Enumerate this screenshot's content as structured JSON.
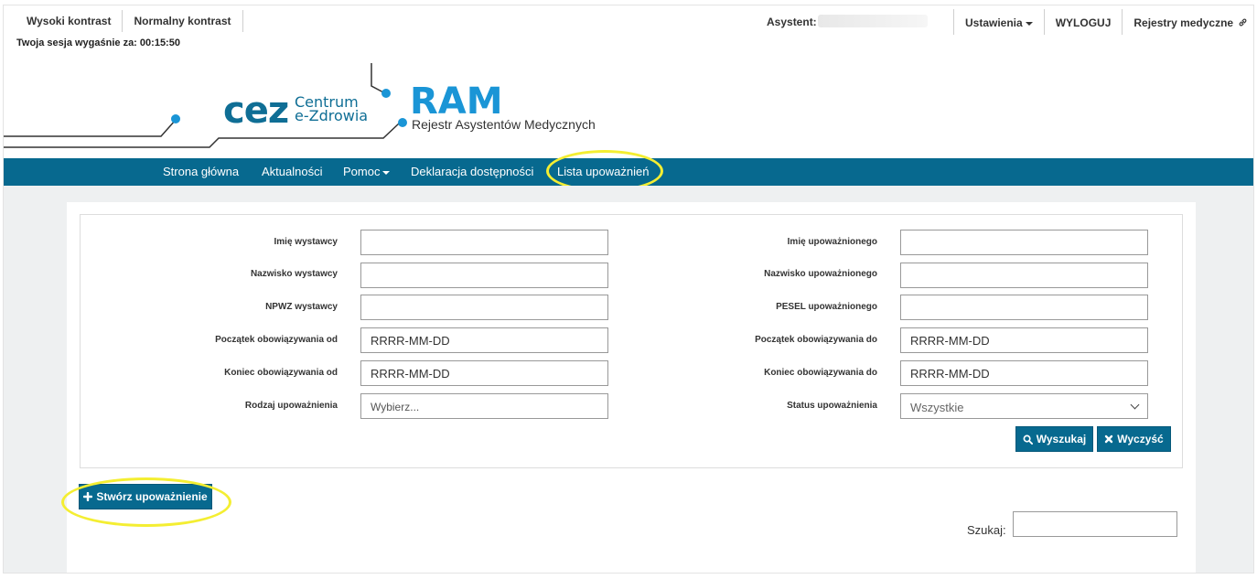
{
  "utility": {
    "high_contrast": "Wysoki kontrast",
    "normal_contrast": "Normalny kontrast",
    "session_label": "Twoja sesja wygaśnie za:",
    "session_time": "00:15:50",
    "assistant_label": "Asystent:",
    "settings": "Ustawienia",
    "logout": "WYLOGUJ",
    "medical_registers": "Rejestry medyczne"
  },
  "brand": {
    "cez": "cez",
    "centrum_line1": "Centrum",
    "centrum_line2": "e-Zdrowia",
    "ram": "RAM",
    "ram_subtitle": "Rejestr Asystentów Medycznych",
    "colors": {
      "primary": "#07698f",
      "accent": "#1a95d6",
      "highlight": "#f4ee32"
    }
  },
  "nav": {
    "home": "Strona główna",
    "news": "Aktualności",
    "help": "Pomoc",
    "accessibility": "Deklaracja dostępności",
    "authorizations": "Lista upoważnień"
  },
  "form": {
    "issuer_first_name": "Imię wystawcy",
    "issuer_last_name": "Nazwisko wystawcy",
    "issuer_npwz": "NPWZ wystawcy",
    "start_from": "Początek obowiązywania od",
    "end_from": "Koniec obowiązywania od",
    "auth_type": "Rodzaj upoważnienia",
    "auth_type_value": "Wybierz...",
    "authorized_first_name": "Imię upoważnionego",
    "authorized_last_name": "Nazwisko upoważnionego",
    "authorized_pesel": "PESEL upoważnionego",
    "start_to": "Początek obowiązywania do",
    "end_to": "Koniec obowiązywania do",
    "auth_status": "Status upoważnienia",
    "auth_status_value": "Wszystkie",
    "date_placeholder": "RRRR-MM-DD",
    "search_button": "Wyszukaj",
    "clear_button": "Wyczyść"
  },
  "actions": {
    "create_authorization": "Stwórz upoważnienie",
    "search_label": "Szukaj:"
  }
}
